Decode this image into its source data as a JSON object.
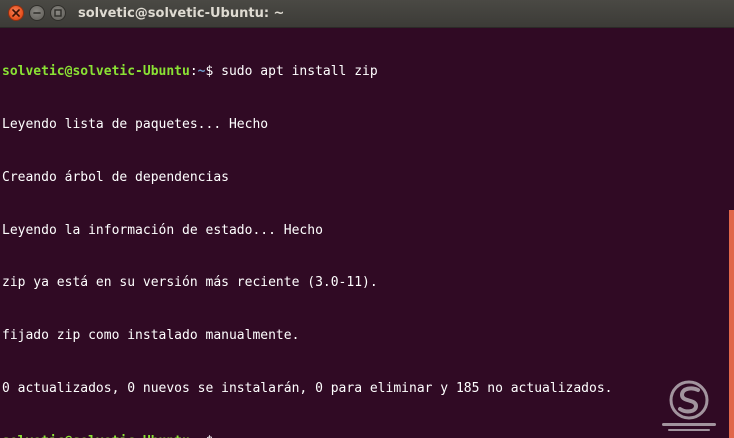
{
  "window": {
    "title": "solvetic@solvetic-Ubuntu: ~"
  },
  "colors": {
    "terminal_bg": "#300a24",
    "prompt_user": "#8ae234",
    "prompt_path": "#729fcf",
    "text": "#ffffff",
    "close_button": "#e95420",
    "scrollbar": "#e0674a"
  },
  "terminal": {
    "prompt": {
      "user_host": "solvetic@solvetic-Ubuntu",
      "separator": ":",
      "path": "~",
      "symbol": "$"
    },
    "command": " sudo apt install zip",
    "output": [
      "Leyendo lista de paquetes... Hecho",
      "Creando árbol de dependencias",
      "Leyendo la información de estado... Hecho",
      "zip ya está en su versión más reciente (3.0-11).",
      "fijado zip como instalado manualmente.",
      "0 actualizados, 0 nuevos se instalarán, 0 para eliminar y 185 no actualizados."
    ]
  },
  "watermark": {
    "icon": "solvetic-logo-icon"
  }
}
